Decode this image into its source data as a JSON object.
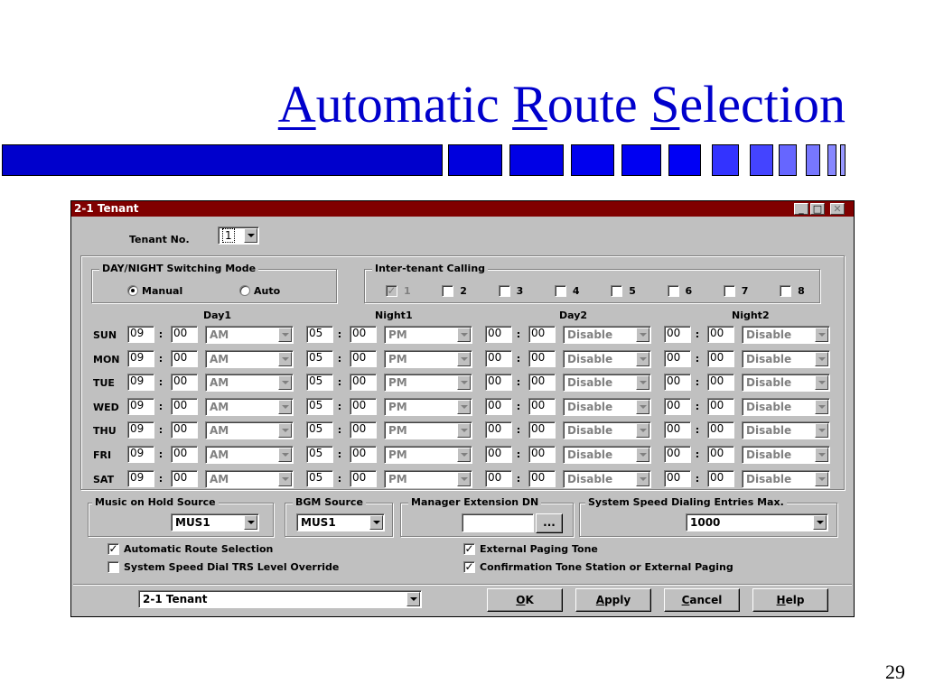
{
  "slide": {
    "title_parts": [
      {
        "t": "A",
        "u": true
      },
      {
        "t": "utomatic ",
        "u": false
      },
      {
        "t": "R",
        "u": true
      },
      {
        "t": "oute ",
        "u": false
      },
      {
        "t": "S",
        "u": true
      },
      {
        "t": "election",
        "u": false
      }
    ],
    "page_number": "29",
    "accent_color": "#0000cc"
  },
  "window": {
    "title": "2-1 Tenant",
    "title_bar_color": "#800000",
    "controls": [
      "minimize-icon",
      "maximize-icon",
      "close-icon"
    ]
  },
  "tenant": {
    "label": "Tenant No.",
    "value": "1"
  },
  "daynight": {
    "title": "DAY/NIGHT Switching Mode",
    "options": [
      {
        "label": "Manual",
        "selected": true
      },
      {
        "label": "Auto",
        "selected": false
      }
    ]
  },
  "intertenant": {
    "title": "Inter-tenant Calling",
    "items": [
      {
        "label": "1",
        "checked": true,
        "disabled": true
      },
      {
        "label": "2",
        "checked": false
      },
      {
        "label": "3",
        "checked": false
      },
      {
        "label": "4",
        "checked": false
      },
      {
        "label": "5",
        "checked": false
      },
      {
        "label": "6",
        "checked": false
      },
      {
        "label": "7",
        "checked": false
      },
      {
        "label": "8",
        "checked": false
      }
    ]
  },
  "schedule": {
    "headers": [
      "Day1",
      "Night1",
      "Day2",
      "Night2"
    ],
    "rows": [
      {
        "day": "SUN",
        "d1h": "09",
        "d1m": "00",
        "d1p": "AM",
        "n1h": "05",
        "n1m": "00",
        "n1p": "PM",
        "d2h": "00",
        "d2m": "00",
        "d2p": "Disable",
        "n2h": "00",
        "n2m": "00",
        "n2p": "Disable"
      },
      {
        "day": "MON",
        "d1h": "09",
        "d1m": "00",
        "d1p": "AM",
        "n1h": "05",
        "n1m": "00",
        "n1p": "PM",
        "d2h": "00",
        "d2m": "00",
        "d2p": "Disable",
        "n2h": "00",
        "n2m": "00",
        "n2p": "Disable"
      },
      {
        "day": "TUE",
        "d1h": "09",
        "d1m": "00",
        "d1p": "AM",
        "n1h": "05",
        "n1m": "00",
        "n1p": "PM",
        "d2h": "00",
        "d2m": "00",
        "d2p": "Disable",
        "n2h": "00",
        "n2m": "00",
        "n2p": "Disable"
      },
      {
        "day": "WED",
        "d1h": "09",
        "d1m": "00",
        "d1p": "AM",
        "n1h": "05",
        "n1m": "00",
        "n1p": "PM",
        "d2h": "00",
        "d2m": "00",
        "d2p": "Disable",
        "n2h": "00",
        "n2m": "00",
        "n2p": "Disable"
      },
      {
        "day": "THU",
        "d1h": "09",
        "d1m": "00",
        "d1p": "AM",
        "n1h": "05",
        "n1m": "00",
        "n1p": "PM",
        "d2h": "00",
        "d2m": "00",
        "d2p": "Disable",
        "n2h": "00",
        "n2m": "00",
        "n2p": "Disable"
      },
      {
        "day": "FRI",
        "d1h": "09",
        "d1m": "00",
        "d1p": "AM",
        "n1h": "05",
        "n1m": "00",
        "n1p": "PM",
        "d2h": "00",
        "d2m": "00",
        "d2p": "Disable",
        "n2h": "00",
        "n2m": "00",
        "n2p": "Disable"
      },
      {
        "day": "SAT",
        "d1h": "09",
        "d1m": "00",
        "d1p": "AM",
        "n1h": "05",
        "n1m": "00",
        "n1p": "PM",
        "d2h": "00",
        "d2m": "00",
        "d2p": "Disable",
        "n2h": "00",
        "n2m": "00",
        "n2p": "Disable"
      }
    ]
  },
  "moh": {
    "title": "Music on Hold Source",
    "value": "MUS1"
  },
  "bgm": {
    "title": "BGM Source",
    "value": "MUS1"
  },
  "manager": {
    "title": "Manager Extension DN",
    "value": "",
    "browse_label": "..."
  },
  "speed": {
    "title": "System Speed Dialing Entries Max.",
    "value": "1000"
  },
  "options": [
    {
      "label": "Automatic Route Selection",
      "checked": true
    },
    {
      "label": "System Speed Dial TRS Level Override",
      "checked": false
    },
    {
      "label": "External Paging Tone",
      "checked": true
    },
    {
      "label": "Confirmation Tone Station or External Paging",
      "checked": true
    }
  ],
  "footer": {
    "nav_value": "2-1 Tenant",
    "buttons": [
      {
        "label": "OK",
        "key": "O"
      },
      {
        "label": "Apply",
        "key": "A"
      },
      {
        "label": "Cancel",
        "key": "C"
      },
      {
        "label": "Help",
        "key": "H"
      }
    ]
  }
}
